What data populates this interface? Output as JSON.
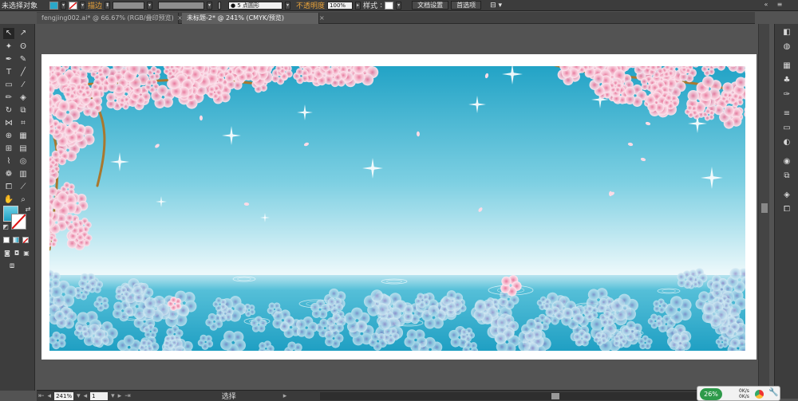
{
  "control_bar": {
    "selection_label": "未选择对象",
    "stroke_label": "描边",
    "brush_value": "5 点圆形",
    "opacity_label": "不透明度",
    "opacity_value": "100%",
    "style_label": "样式",
    "doc_setup": "文档设置",
    "preferences": "首选项"
  },
  "tabs": [
    {
      "label": "fengjing002.ai* @ 66.67% (RGB/叠印预览)",
      "active": false
    },
    {
      "label": "未标题-2* @ 241% (CMYK/预览)",
      "active": true
    }
  ],
  "status_bar": {
    "zoom": "241%",
    "page": "1",
    "tool": "选择"
  },
  "network_widget": {
    "percent": "26%",
    "up": "0K/s",
    "down": "0K/s"
  },
  "colors": {
    "sky_top": "#22a3c6",
    "sky_bottom": "#eef9fb",
    "water": "#36b1d0",
    "blossom": "#f7c8d8",
    "blossom_center": "#e7789c",
    "water_blossom": "#a9cde6"
  }
}
